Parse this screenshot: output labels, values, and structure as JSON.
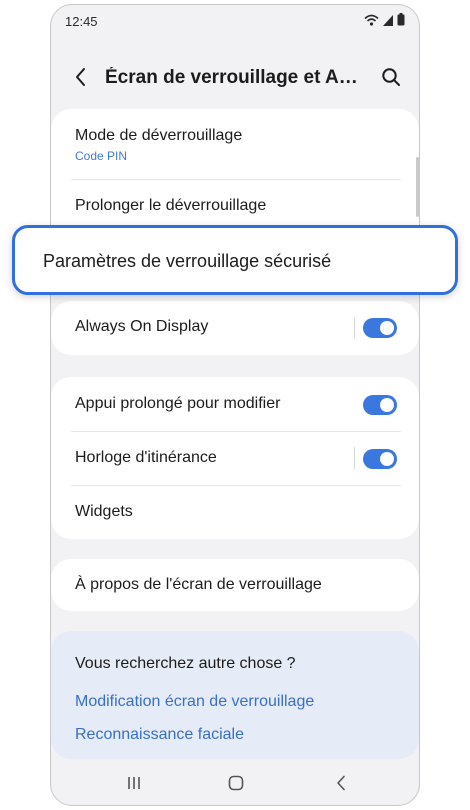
{
  "status_bar": {
    "time": "12:45",
    "icons": [
      "wifi-icon",
      "signal-icon",
      "battery-icon"
    ]
  },
  "header": {
    "back_icon": "chevron-left-icon",
    "title": "Écran de verrouillage et A…",
    "search_icon": "search-icon"
  },
  "section1": {
    "unlock_mode": {
      "label": "Mode de déverrouillage",
      "value": "Code PIN"
    },
    "extend_unlock": {
      "label": "Prolonger le déverrouillage"
    }
  },
  "highlighted_item": {
    "label": "Paramètres de verrouillage sécurisé"
  },
  "section2": {
    "always_on_display": {
      "label": "Always On Display",
      "enabled": true
    }
  },
  "section3": {
    "long_press_edit": {
      "label": "Appui prolongé pour modifier",
      "enabled": true
    },
    "roaming_clock": {
      "label": "Horloge d'itinérance",
      "enabled": true
    },
    "widgets": {
      "label": "Widgets"
    }
  },
  "section4": {
    "about": {
      "label": "À propos de l'écran de verrouillage"
    }
  },
  "suggestions": {
    "title": "Vous recherchez autre chose ?",
    "links": [
      "Modification écran de verrouillage",
      "Reconnaissance faciale"
    ]
  },
  "nav_bar": {
    "icons": [
      "recents-icon",
      "home-icon",
      "back-icon"
    ]
  },
  "colors": {
    "accent": "#3a78e0",
    "highlight_border": "#2f6fe0",
    "link": "#3a6fc8",
    "suggest_bg": "#e5ecf7",
    "screen_bg": "#f2f2f4"
  }
}
